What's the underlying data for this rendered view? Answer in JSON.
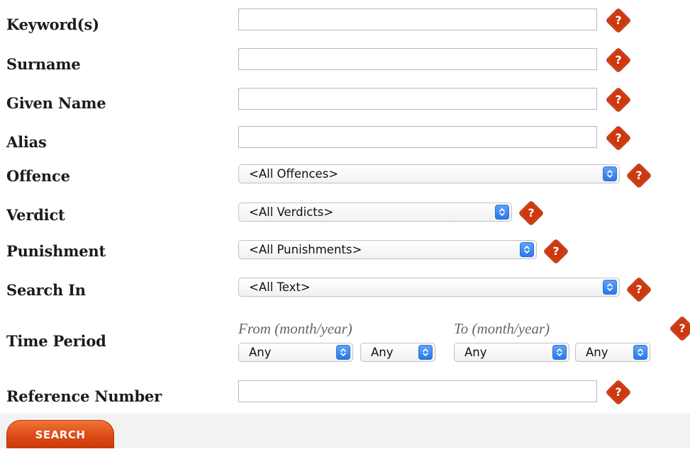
{
  "form": {
    "fields": {
      "keywords": {
        "label": "Keyword(s)",
        "value": ""
      },
      "surname": {
        "label": "Surname",
        "value": ""
      },
      "given_name": {
        "label": "Given Name",
        "value": ""
      },
      "alias": {
        "label": "Alias",
        "value": ""
      },
      "offence": {
        "label": "Offence",
        "selected": "<All Offences>"
      },
      "verdict": {
        "label": "Verdict",
        "selected": "<All Verdicts>"
      },
      "punishment": {
        "label": "Punishment",
        "selected": "<All Punishments>"
      },
      "search_in": {
        "label": "Search In",
        "selected": "<All Text>"
      },
      "time_period": {
        "label": "Time Period",
        "from_label": "From (month/year)",
        "to_label": "To (month/year)",
        "from_month": "Any",
        "from_year": "Any",
        "to_month": "Any",
        "to_year": "Any"
      },
      "reference_number": {
        "label": "Reference Number",
        "value": ""
      }
    },
    "help_glyph": "?",
    "search_button": "SEARCH"
  },
  "colors": {
    "help_icon": "#cc3810",
    "select_arrow": "#2a78eb",
    "search_button": "#dd4a14",
    "footer_bg": "#f2f2f2"
  }
}
